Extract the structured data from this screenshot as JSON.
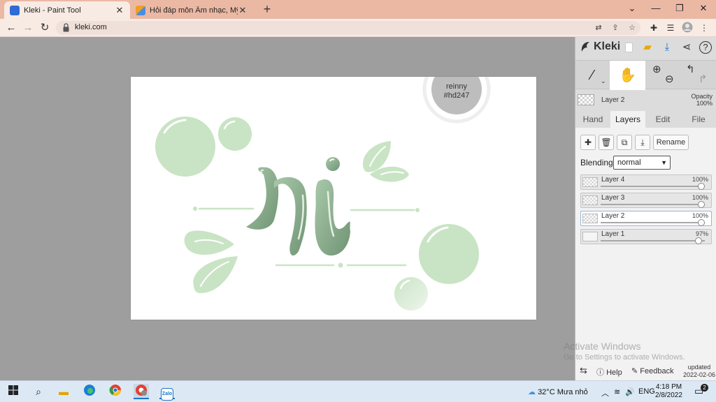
{
  "browser": {
    "tabs": [
      {
        "title": "Kleki - Paint Tool",
        "active": true,
        "favicon_color": "#2f6cd6"
      },
      {
        "title": "Hỏi đáp môn Âm nhạc, Mỹ thuật",
        "active": false,
        "favicon_color": "#f0a020"
      }
    ],
    "url": "kleki.com",
    "icons": {
      "back": "arrow-left-icon",
      "forward": "arrow-right-icon",
      "reload": "reload-icon",
      "lock": "lock-icon",
      "translate": "translate-icon",
      "share": "share-icon",
      "bookmark": "star-icon",
      "extensions": "puzzle-icon",
      "menu": "kebab-icon"
    }
  },
  "kleki": {
    "brand": "Kleki",
    "header_icons": [
      "new-image-icon",
      "open-folder-icon",
      "download-icon",
      "share-icon",
      "help-icon"
    ],
    "tools": [
      "brush-tool",
      "hand-tool",
      "zoom-tool",
      "undo-redo"
    ],
    "layer_info": {
      "name": "Layer 2",
      "opacity_label": "Opacity",
      "opacity_value": "100%"
    },
    "tabs": [
      "Hand",
      "Layers",
      "Edit",
      "File"
    ],
    "active_tab": "Layers",
    "layer_buttons": {
      "rename": "Rename"
    },
    "blending": {
      "label": "Blending",
      "value": "normal"
    },
    "layers": [
      {
        "name": "Layer 4",
        "opacity": "100%",
        "level": 1.0,
        "selected": false
      },
      {
        "name": "Layer 3",
        "opacity": "100%",
        "level": 1.0,
        "selected": false
      },
      {
        "name": "Layer 2",
        "opacity": "100%",
        "level": 1.0,
        "selected": true
      },
      {
        "name": "Layer 1",
        "opacity": "97%",
        "level": 0.97,
        "selected": false
      }
    ],
    "footer": {
      "help": "Help",
      "feedback": "Feedback",
      "updated_label": "updated",
      "updated_date": "2022-02-06"
    }
  },
  "artwork": {
    "badge_line1": "reinny",
    "badge_line2": "#hd247",
    "accent": "#c9e4c4",
    "letter_color": "#8aae8c"
  },
  "watermark": {
    "line1": "Activate Windows",
    "line2": "Go to Settings to activate Windows."
  },
  "taskbar": {
    "weather": "32°C  Mưa nhỏ",
    "lang": "ENG",
    "time": "4:18 PM",
    "date": "2/8/2022",
    "notifications": "2"
  }
}
